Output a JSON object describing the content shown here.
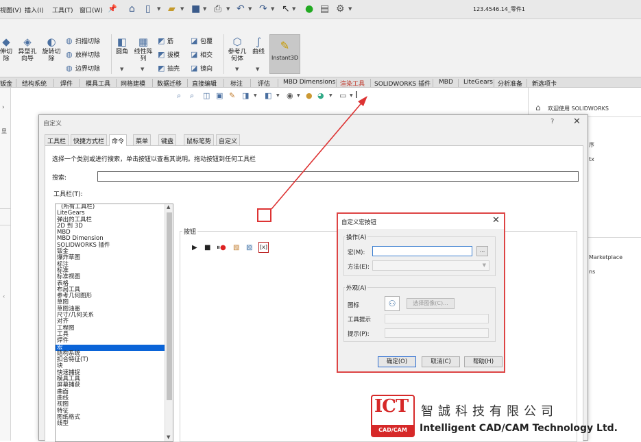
{
  "menubar": {
    "items": [
      "视图(V)",
      "插入(I)",
      "工具(T)",
      "窗口(W)"
    ],
    "document_title": "123.4546.14_零件1"
  },
  "ribbon": {
    "big_buttons": [
      {
        "label": "伸切\n除",
        "icon": "extrude-cut-icon"
      },
      {
        "label": "异型孔\n向导",
        "icon": "hole-wizard-icon"
      },
      {
        "label": "旋转切\n除",
        "icon": "revolve-cut-icon"
      },
      {
        "label": "圆角",
        "icon": "fillet-icon"
      },
      {
        "label": "线性阵\n列",
        "icon": "linear-pattern-icon"
      },
      {
        "label": "参考几\n何体",
        "icon": "reference-geometry-icon"
      },
      {
        "label": "曲线",
        "icon": "curves-icon"
      }
    ],
    "small_buttons": [
      {
        "label": "扫描切除",
        "icon": "swept-cut-icon"
      },
      {
        "label": "放样切除",
        "icon": "lofted-cut-icon"
      },
      {
        "label": "边界切除",
        "icon": "boundary-cut-icon"
      },
      {
        "label": "筋",
        "icon": "rib-icon"
      },
      {
        "label": "拔模",
        "icon": "draft-icon"
      },
      {
        "label": "抽壳",
        "icon": "shell-icon"
      },
      {
        "label": "包覆",
        "icon": "wrap-icon"
      },
      {
        "label": "相交",
        "icon": "intersect-icon"
      },
      {
        "label": "镜向",
        "icon": "mirror-icon"
      }
    ],
    "instant3d_label": "Instant3D"
  },
  "cm_tabs": [
    "钣金",
    "结构系统",
    "焊件",
    "模具工具",
    "网格建模",
    "数据迁移",
    "直接编辑",
    "标注",
    "评估",
    "MBD Dimensions",
    "渲染工具",
    "SOLIDWORKS 插件",
    "MBD",
    "LiteGears",
    "分析准备",
    "新选项卡"
  ],
  "right_panel": {
    "welcome": "欢迎使用 SOLIDWORKS",
    "fragments": [
      "序",
      "tx",
      "Marketplace",
      "ns"
    ]
  },
  "left_strip": {
    "glyphs": [
      "›",
      "显",
      "‹"
    ]
  },
  "customize_dialog": {
    "title": "自定义",
    "help_symbol": "?",
    "close_symbol": "✕",
    "tabs": [
      "工具栏",
      "快捷方式栏",
      "命令",
      "菜单",
      "键盘",
      "鼠标笔势",
      "自定义"
    ],
    "active_tab": 2,
    "instruction": "选择一个类别或进行搜索，单击按钮以查看其说明。拖动按钮到任何工具栏",
    "search_label": "搜索:",
    "search_value": "",
    "toolbars_label": "工具栏(T):",
    "categories": [
      "(所有工具栏)",
      "LiteGears",
      "弹出的工具栏",
      "2D 到 3D",
      "MBD",
      "MBD Dimension",
      "SOLIDWORKS 插件",
      "钣金",
      "爆炸草图",
      "标注",
      "标准",
      "标准视图",
      "表格",
      "布局工具",
      "参考几何图形",
      "草图",
      "草图油墨",
      "尺寸/几何关系",
      "对齐",
      "工程图",
      "工具",
      "焊件",
      "宏",
      "结构系统",
      "扣合特征(T)",
      "块",
      "快速捕捉",
      "模具工具",
      "屏幕捕获",
      "曲面",
      "曲线",
      "视图",
      "特征",
      "图纸格式",
      "线型"
    ],
    "selected_category": "宏",
    "buttons_group_label": "按钮"
  },
  "macro_dialog": {
    "title": "自定义宏按钮",
    "close_symbol": "✕",
    "operation_label": "操作(A)",
    "macro_label": "宏(M):",
    "macro_value": "",
    "browse_label": "...",
    "method_label": "方法(E):",
    "method_value": "",
    "appearance_label": "外观(A)",
    "icon_label": "图标",
    "choose_image_label": "选择图像(C)...",
    "tooltip_label": "工具提示",
    "prompt_label": "提示(P):",
    "ok_label": "确定(O)",
    "cancel_label": "取消(C)",
    "help_label": "帮助(H)"
  },
  "watermark": {
    "logo_top": "ICT",
    "logo_bottom": "CAD/CAM",
    "company_cn": "智誠科技有限公司",
    "company_en": "Intelligent CAD/CAM Technology Ltd."
  },
  "colors": {
    "accent": "#0a64d8",
    "annotation": "#d33333",
    "brand": "#d62828"
  }
}
